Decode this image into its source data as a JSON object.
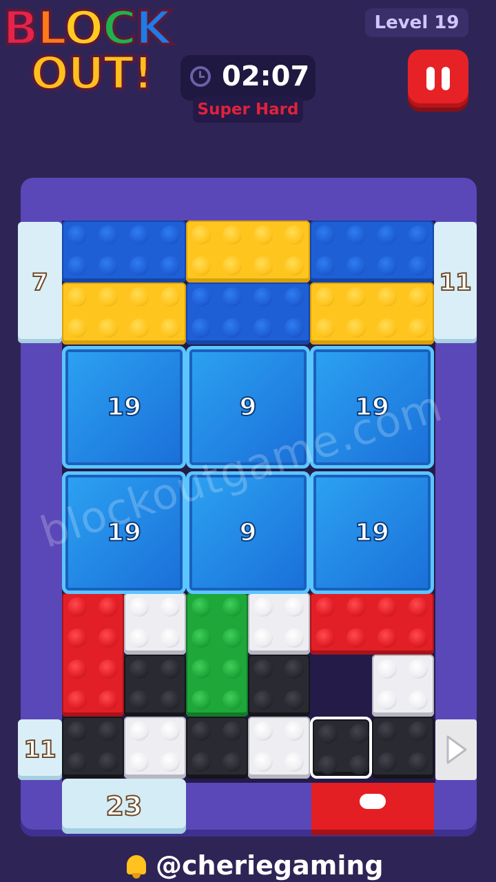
{
  "header": {
    "logo_line1": [
      "B",
      "L",
      "O",
      "C",
      "K"
    ],
    "logo_line2": "OUT!",
    "level_label": "Level 19",
    "timer": "02:07",
    "difficulty": "Super Hard"
  },
  "doors": {
    "left_top": "7",
    "right_top": "11",
    "left_bottom": "11",
    "bottom_left": "23"
  },
  "ice_blocks": [
    "19",
    "9",
    "19",
    "19",
    "9",
    "19"
  ],
  "watermark": "blockoutgame.com",
  "footer": {
    "handle": "@cheriegaming"
  },
  "colors": {
    "blue": "#1f5fd6",
    "yellow": "#ffc51f",
    "red": "#e21f26",
    "green": "#1fa83a",
    "white": "#eeeef2",
    "black": "#2a2a32"
  },
  "blocks": [
    {
      "color": "blue",
      "cols": 4,
      "rows": 2
    },
    {
      "color": "yellow",
      "cols": 4,
      "rows": 2
    },
    {
      "color": "blue",
      "cols": 4,
      "rows": 2
    },
    {
      "color": "yellow",
      "cols": 4,
      "rows": 2
    },
    {
      "color": "blue",
      "cols": 4,
      "rows": 2
    },
    {
      "color": "yellow",
      "cols": 4,
      "rows": 2
    },
    {
      "color": "red",
      "cols": 2,
      "rows": 4
    },
    {
      "color": "white",
      "cols": 2,
      "rows": 2
    },
    {
      "color": "green",
      "cols": 2,
      "rows": 4
    },
    {
      "color": "white",
      "cols": 2,
      "rows": 2
    },
    {
      "color": "red",
      "cols": 4,
      "rows": 2
    },
    {
      "color": "black",
      "cols": 2,
      "rows": 2
    },
    {
      "color": "black",
      "cols": 2,
      "rows": 2
    },
    {
      "color": "white",
      "cols": 2,
      "rows": 2
    },
    {
      "color": "black",
      "cols": 2,
      "rows": 2
    },
    {
      "color": "white",
      "cols": 2,
      "rows": 2
    },
    {
      "color": "black",
      "cols": 2,
      "rows": 2
    },
    {
      "color": "white",
      "cols": 2,
      "rows": 2
    },
    {
      "color": "black",
      "cols": 2,
      "rows": 2,
      "selected": true
    },
    {
      "color": "black",
      "cols": 2,
      "rows": 2
    }
  ]
}
